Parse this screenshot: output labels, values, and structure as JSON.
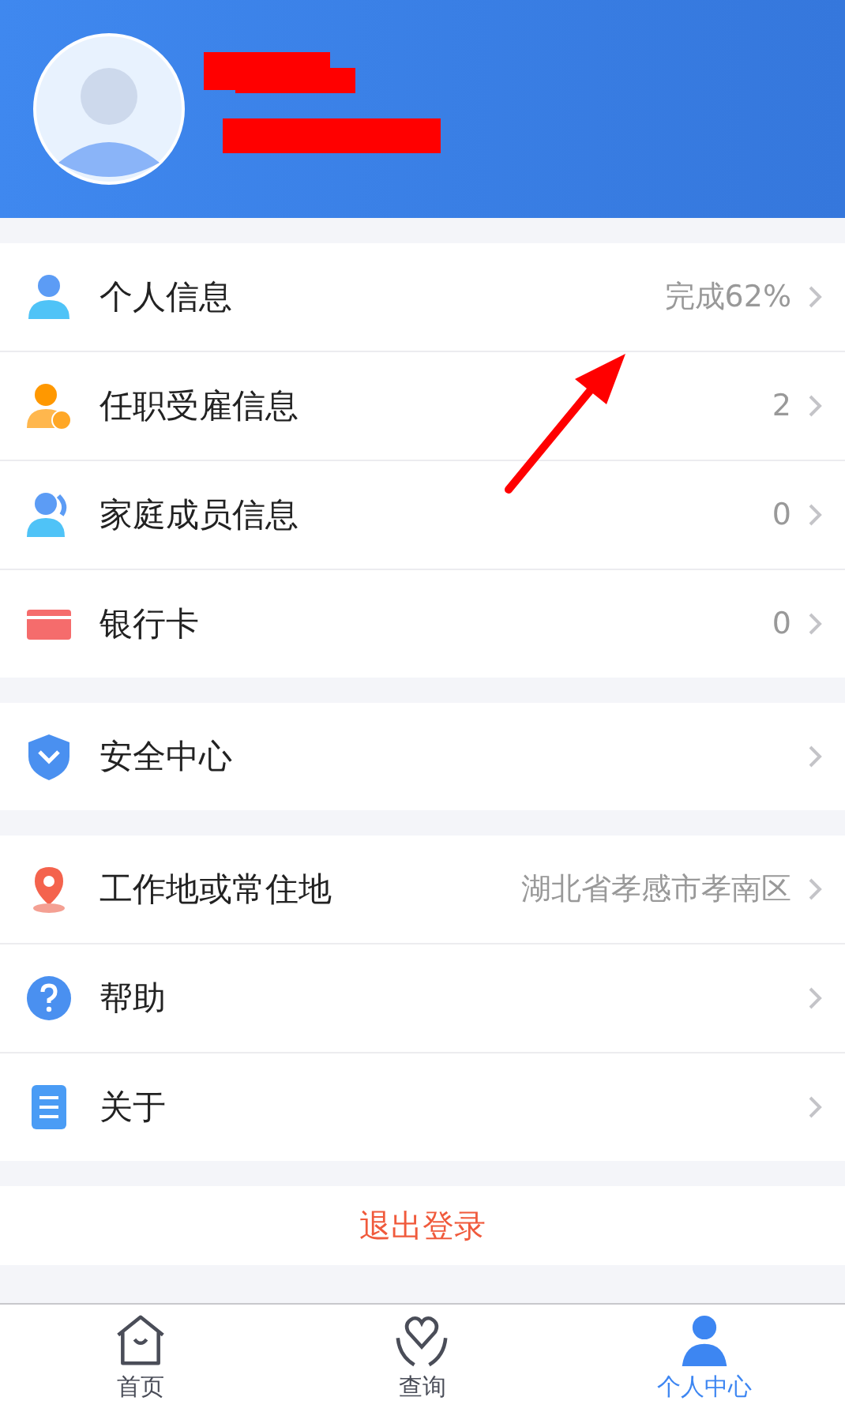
{
  "groups": [
    {
      "items": [
        {
          "label": "个人信息",
          "value": "完成62%"
        },
        {
          "label": "任职受雇信息",
          "value": "2"
        },
        {
          "label": "家庭成员信息",
          "value": "0"
        },
        {
          "label": "银行卡",
          "value": "0"
        }
      ]
    },
    {
      "items": [
        {
          "label": "安全中心"
        }
      ]
    },
    {
      "items": [
        {
          "label": "工作地或常住地",
          "value": "湖北省孝感市孝南区"
        },
        {
          "label": "帮助"
        },
        {
          "label": "关于"
        }
      ]
    }
  ],
  "logout": "退出登录",
  "tabs": [
    {
      "label": "首页",
      "selected": false
    },
    {
      "label": "查询",
      "selected": false
    },
    {
      "label": "个人中心",
      "selected": true
    }
  ]
}
